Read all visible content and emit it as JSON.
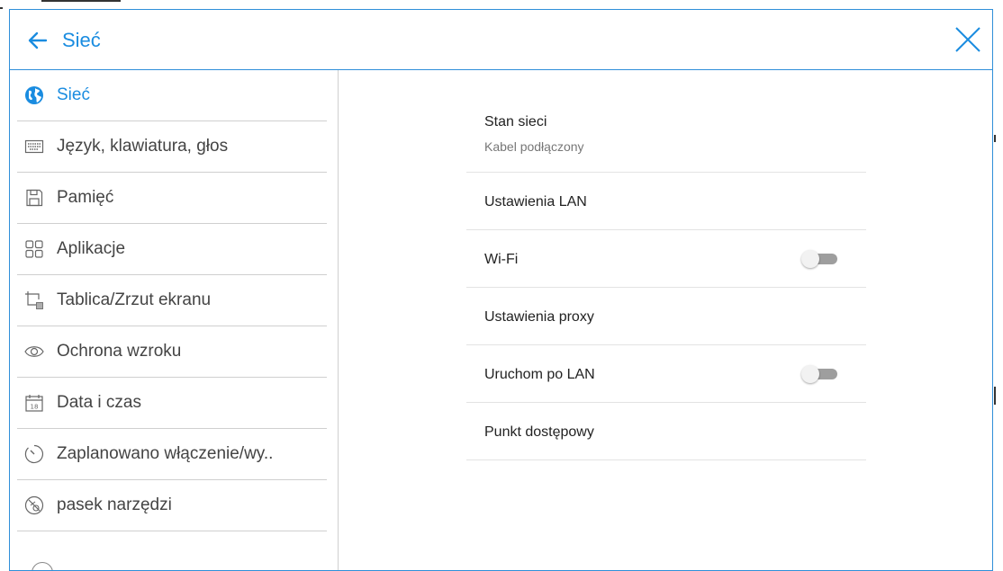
{
  "header": {
    "title": "Sieć"
  },
  "sidebar": {
    "items": [
      {
        "label": "Sieć"
      },
      {
        "label": "Język, klawiatura, głos"
      },
      {
        "label": "Pamięć"
      },
      {
        "label": "Aplikacje"
      },
      {
        "label": "Tablica/Zrzut ekranu"
      },
      {
        "label": "Ochrona wzroku"
      },
      {
        "label": "Data i czas",
        "date_number": "18"
      },
      {
        "label": "Zaplanowano włączenie/wy.."
      },
      {
        "label": "pasek narzędzi"
      }
    ]
  },
  "main": {
    "rows": [
      {
        "title": "Stan sieci",
        "subtitle": "Kabel podłączony"
      },
      {
        "title": "Ustawienia LAN"
      },
      {
        "title": "Wi-Fi",
        "toggle": "off"
      },
      {
        "title": "Ustawienia proxy"
      },
      {
        "title": "Uruchom po LAN",
        "toggle": "off"
      },
      {
        "title": "Punkt dostępowy"
      }
    ]
  },
  "colors": {
    "accent": "#1a8ce0",
    "frame": "#2f8fd9",
    "toggle_off": "#9e9e9e"
  }
}
